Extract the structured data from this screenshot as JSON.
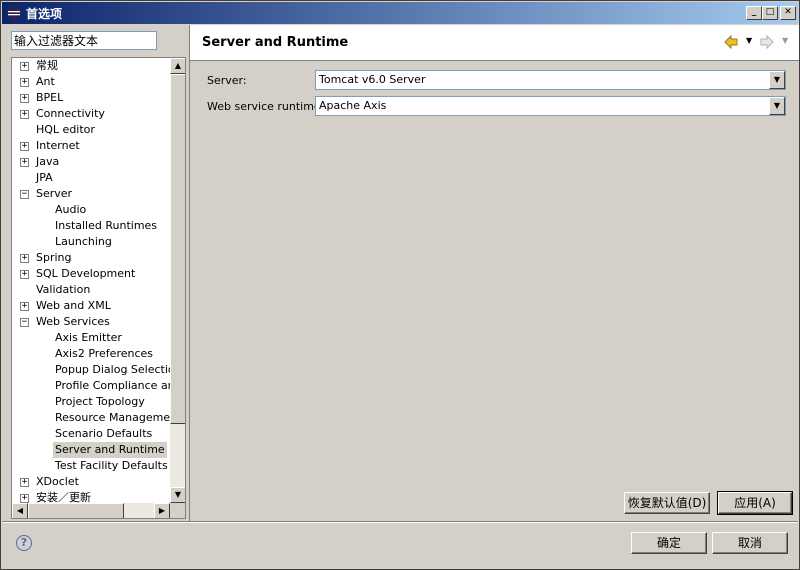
{
  "window": {
    "title": "首选项"
  },
  "filter": {
    "value": "输入过滤器文本"
  },
  "tree": [
    {
      "label": "常规",
      "level": 0,
      "expander": "+"
    },
    {
      "label": "Ant",
      "level": 0,
      "expander": "+"
    },
    {
      "label": "BPEL",
      "level": 0,
      "expander": "+"
    },
    {
      "label": "Connectivity",
      "level": 0,
      "expander": "+"
    },
    {
      "label": "HQL editor",
      "level": 0,
      "expander": ""
    },
    {
      "label": "Internet",
      "level": 0,
      "expander": "+"
    },
    {
      "label": "Java",
      "level": 0,
      "expander": "+"
    },
    {
      "label": "JPA",
      "level": 0,
      "expander": ""
    },
    {
      "label": "Server",
      "level": 0,
      "expander": "-"
    },
    {
      "label": "Audio",
      "level": 1,
      "expander": ""
    },
    {
      "label": "Installed Runtimes",
      "level": 1,
      "expander": ""
    },
    {
      "label": "Launching",
      "level": 1,
      "expander": ""
    },
    {
      "label": "Spring",
      "level": 0,
      "expander": "+"
    },
    {
      "label": "SQL Development",
      "level": 0,
      "expander": "+"
    },
    {
      "label": "Validation",
      "level": 0,
      "expander": ""
    },
    {
      "label": "Web and XML",
      "level": 0,
      "expander": "+"
    },
    {
      "label": "Web Services",
      "level": 0,
      "expander": "-"
    },
    {
      "label": "Axis Emitter",
      "level": 1,
      "expander": ""
    },
    {
      "label": "Axis2 Preferences",
      "level": 1,
      "expander": ""
    },
    {
      "label": "Popup Dialog Selection",
      "level": 1,
      "expander": ""
    },
    {
      "label": "Profile Compliance and V",
      "level": 1,
      "expander": ""
    },
    {
      "label": "Project Topology",
      "level": 1,
      "expander": ""
    },
    {
      "label": "Resource Management",
      "level": 1,
      "expander": ""
    },
    {
      "label": "Scenario Defaults",
      "level": 1,
      "expander": ""
    },
    {
      "label": "Server and Runtime",
      "level": 1,
      "expander": "",
      "selected": true
    },
    {
      "label": "Test Facility Defaults",
      "level": 1,
      "expander": ""
    },
    {
      "label": "XDoclet",
      "level": 0,
      "expander": "+"
    },
    {
      "label": "安装／更新",
      "level": 0,
      "expander": "+"
    }
  ],
  "page": {
    "title": "Server and Runtime",
    "server_label": "Server:",
    "server_value": "Tomcat v6.0 Server",
    "runtime_label": "Web service runtime:",
    "runtime_value": "Apache Axis"
  },
  "buttons": {
    "restore_defaults": "恢复默认值(D)",
    "apply": "应用(A)",
    "ok": "确定",
    "cancel": "取消"
  },
  "icons": {
    "back": "arrow-left-icon",
    "forward": "arrow-right-icon",
    "help": "help-icon"
  }
}
